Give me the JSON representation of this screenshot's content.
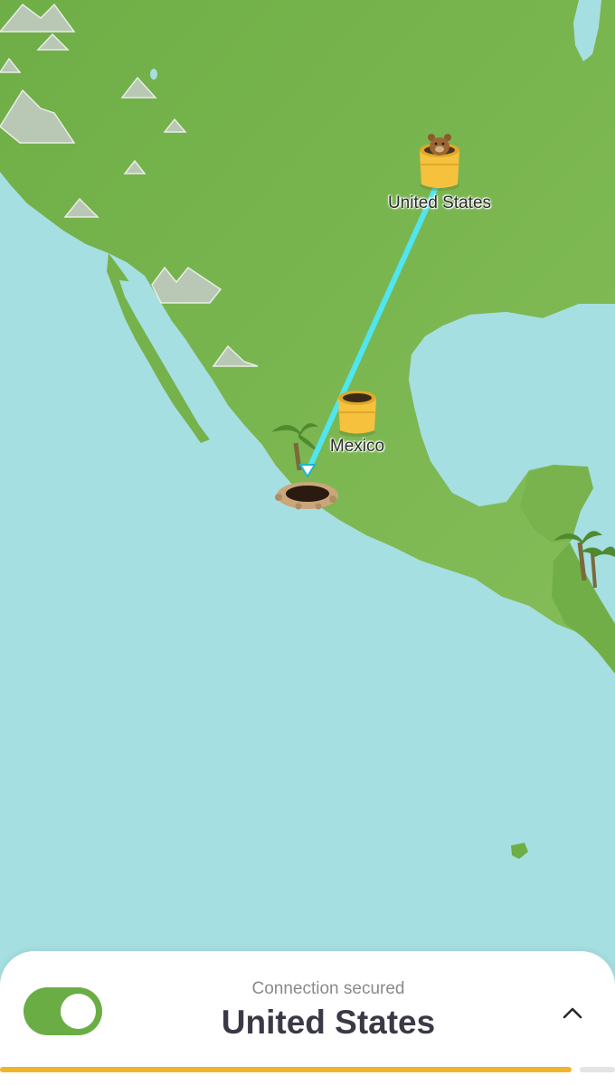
{
  "map": {
    "markers": {
      "destination_label": "United States",
      "origin_label": "Mexico"
    }
  },
  "status": {
    "text": "Connection secured",
    "location": "United States",
    "vpn_enabled": true
  },
  "progress": {
    "fraction": 0.93
  },
  "icons": {
    "expand": "chevron-up-icon"
  },
  "colors": {
    "ocean": "#a6dfe1",
    "land": "#79b44f",
    "route": "#4fe6f0",
    "toggle_on": "#6bad45",
    "progress": "#f0b429",
    "barrel": "#f6c23e"
  }
}
